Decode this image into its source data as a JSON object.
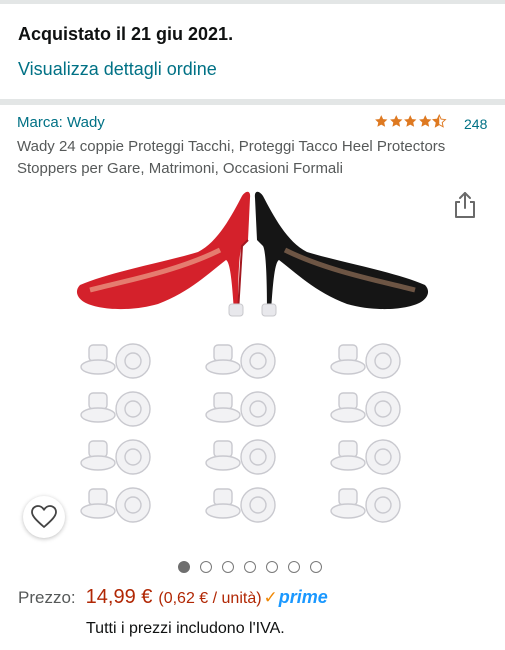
{
  "order": {
    "purchased_label": "Acquistato il 21 giu 2021.",
    "details_link": "Visualizza dettagli ordine"
  },
  "product": {
    "brand": "Marca: Wady",
    "rating": 4.5,
    "rating_count": "248",
    "title": "Wady 24 coppie Proteggi Tacchi, Proteggi Tacco Heel Protectors Stoppers per Gare, Matrimoni, Occasioni Formali",
    "image_icon": "heels-and-protectors-image",
    "share_icon": "share-icon",
    "wishlist_icon": "heart-icon",
    "carousel": {
      "total": 7,
      "active_index": 0
    }
  },
  "pricing": {
    "label": "Prezzo:",
    "price": "14,99 €",
    "unit_price": "(0,62 € / unità)",
    "prime_label": "prime",
    "prime_check": "✓",
    "vat_note": "Tutti i prezzi includono l'IVA."
  },
  "colors": {
    "link": "#007185",
    "price": "#b12704",
    "star": "#de7921",
    "prime": "#1a98ff",
    "divider": "#e3e6e6"
  }
}
